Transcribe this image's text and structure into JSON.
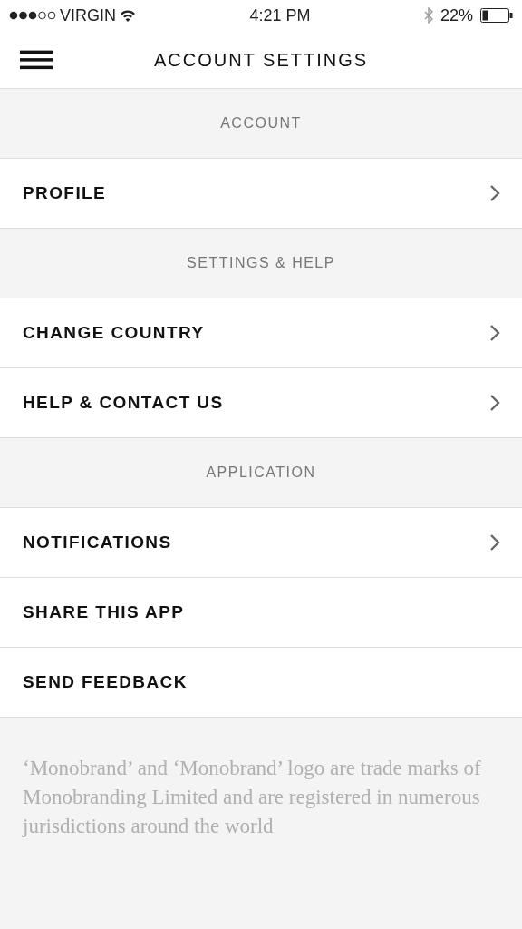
{
  "status_bar": {
    "carrier": "VIRGIN",
    "time": "4:21 PM",
    "battery": "22%"
  },
  "nav_bar": {
    "title": "ACCOUNT SETTINGS"
  },
  "sections": [
    {
      "title": "ACCOUNT",
      "items": [
        {
          "label": "PROFILE",
          "chevron": true
        }
      ]
    },
    {
      "title": "SETTINGS & HELP",
      "items": [
        {
          "label": "CHANGE COUNTRY",
          "chevron": true
        },
        {
          "label": "HELP & CONTACT US",
          "chevron": true
        }
      ]
    },
    {
      "title": "APPLICATION",
      "items": [
        {
          "label": "NOTIFICATIONS",
          "chevron": true
        },
        {
          "label": "SHARE THIS APP",
          "chevron": false
        },
        {
          "label": "SEND FEEDBACK",
          "chevron": false
        }
      ]
    }
  ],
  "footer": {
    "text": "‘Monobrand’ and ‘Monobrand’ logo are trade marks of Monobranding Limited and are registered in numerous jurisdictions around the world"
  }
}
